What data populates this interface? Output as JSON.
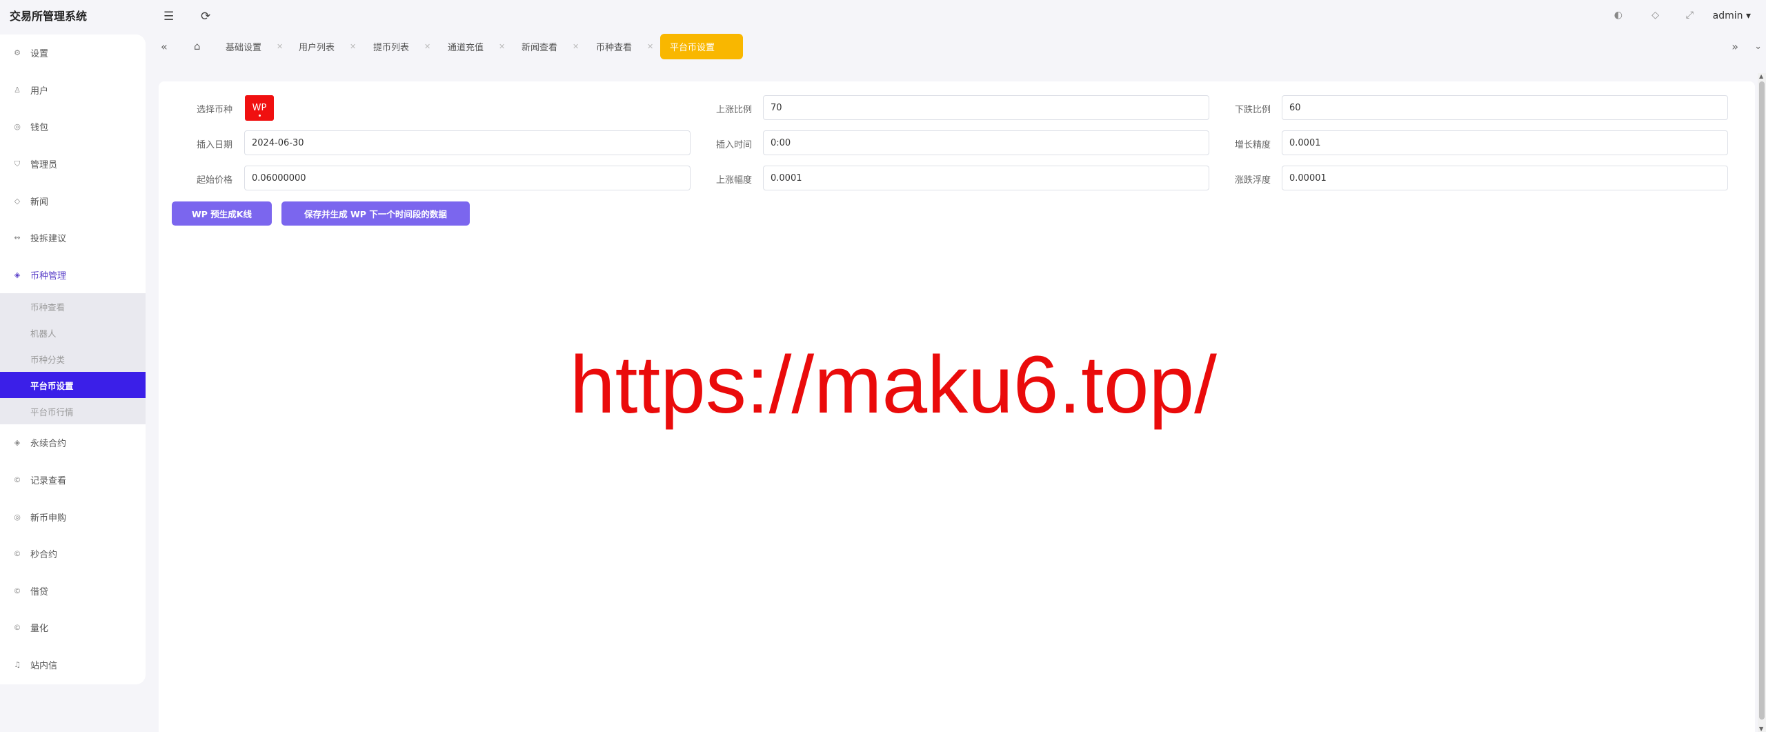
{
  "app": {
    "title": "交易所管理系统",
    "user": "admin"
  },
  "sidebar": {
    "items_top": [
      {
        "label": "设置",
        "icon": "⚙"
      },
      {
        "label": "用户",
        "icon": "♙"
      },
      {
        "label": "钱包",
        "icon": "◎"
      },
      {
        "label": "管理员",
        "icon": "⛉"
      },
      {
        "label": "新闻",
        "icon": "◇"
      },
      {
        "label": "投拆建议",
        "icon": "↭"
      },
      {
        "label": "币种管理",
        "icon": "◈"
      }
    ],
    "sub_items": [
      "币种查看",
      "机器人",
      "币种分类",
      "平台币设置",
      "平台币行情"
    ],
    "items_bottom": [
      {
        "label": "永续合约",
        "icon": "◈"
      },
      {
        "label": "记录查看",
        "icon": "©"
      },
      {
        "label": "新币申购",
        "icon": "◎"
      },
      {
        "label": "秒合约",
        "icon": "©"
      },
      {
        "label": "借贷",
        "icon": "©"
      },
      {
        "label": "量化",
        "icon": "©"
      },
      {
        "label": "站内信",
        "icon": "♫"
      }
    ]
  },
  "tabs": [
    "基础设置",
    "用户列表",
    "提币列表",
    "通道充值",
    "新闻查看",
    "币种查看",
    "平台币设置"
  ],
  "form": {
    "coin_label": "选择币种",
    "coin_value": "WP",
    "rise_ratio_label": "上涨比例",
    "rise_ratio": "70",
    "fall_ratio_label": "下跌比例",
    "fall_ratio": "60",
    "insert_date_label": "插入日期",
    "insert_date": "2024-06-30",
    "insert_time_label": "插入时间",
    "insert_time": "0:00",
    "growth_precision_label": "增长精度",
    "growth_precision": "0.0001",
    "start_price_label": "起始价格",
    "start_price": "0.06000000",
    "rise_amp_label": "上涨幅度",
    "rise_amp": "0.0001",
    "float_label": "涨跌浮度",
    "float": "0.00001"
  },
  "buttons": {
    "generate": "WP 预生成K线",
    "save": "保存并生成 WP 下一个时间段的数据"
  },
  "watermark": "https://maku6.top/",
  "colors": {
    "accent": "#3b1fe8",
    "active_tab": "#f9b700",
    "button": "#7b66ee",
    "watermark": "#ea0b0b"
  }
}
